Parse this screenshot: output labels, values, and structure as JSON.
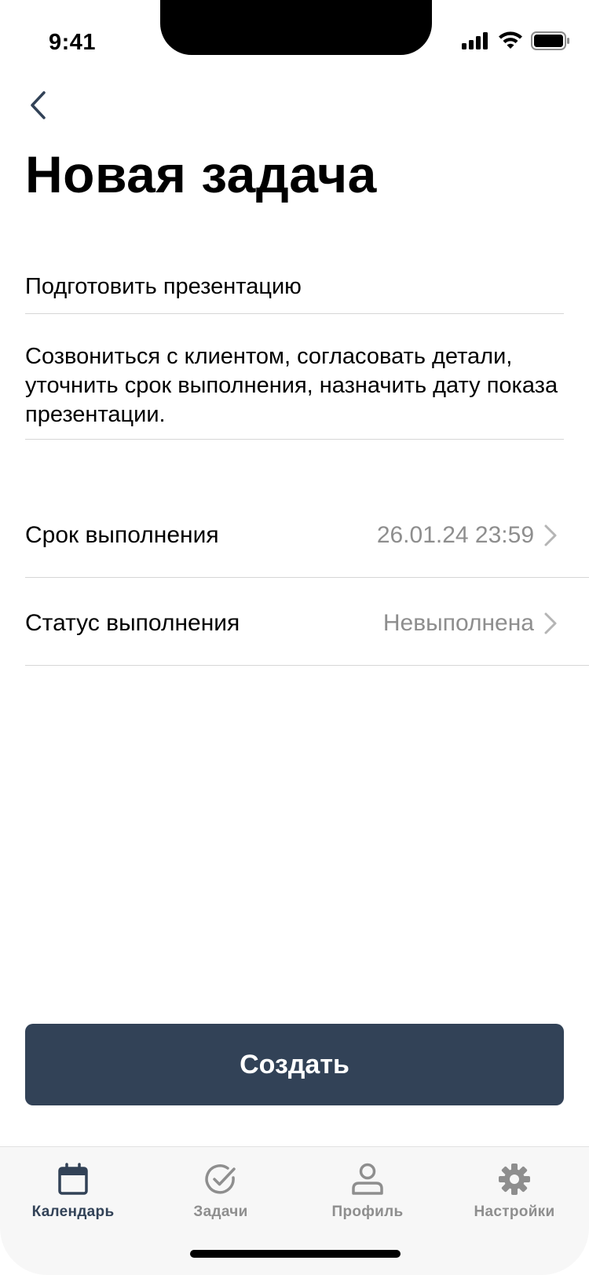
{
  "status_bar": {
    "time": "9:41"
  },
  "page": {
    "title": "Новая задача"
  },
  "task": {
    "title": "Подготовить презентацию",
    "description": "Созвониться с клиентом, согласовать детали, уточнить срок выполнения, назначить дату показа презентации."
  },
  "rows": [
    {
      "label": "Срок выполнения",
      "value": "26.01.24 23:59"
    },
    {
      "label": "Статус выполнения",
      "value": "Невыполнена"
    }
  ],
  "actions": {
    "create_label": "Создать"
  },
  "tabbar": {
    "active": "calendar",
    "items": [
      {
        "id": "calendar",
        "label": "Календарь",
        "icon": "calendar-icon"
      },
      {
        "id": "tasks",
        "label": "Задачи",
        "icon": "check-circle-icon"
      },
      {
        "id": "profile",
        "label": "Профиль",
        "icon": "person-icon"
      },
      {
        "id": "settings",
        "label": "Настройки",
        "icon": "gear-icon"
      }
    ]
  },
  "colors": {
    "accent": "#324257",
    "muted_text": "#8e8e8e",
    "divider": "#d6d6d6",
    "tabbar_bg": "#f7f7f7"
  }
}
